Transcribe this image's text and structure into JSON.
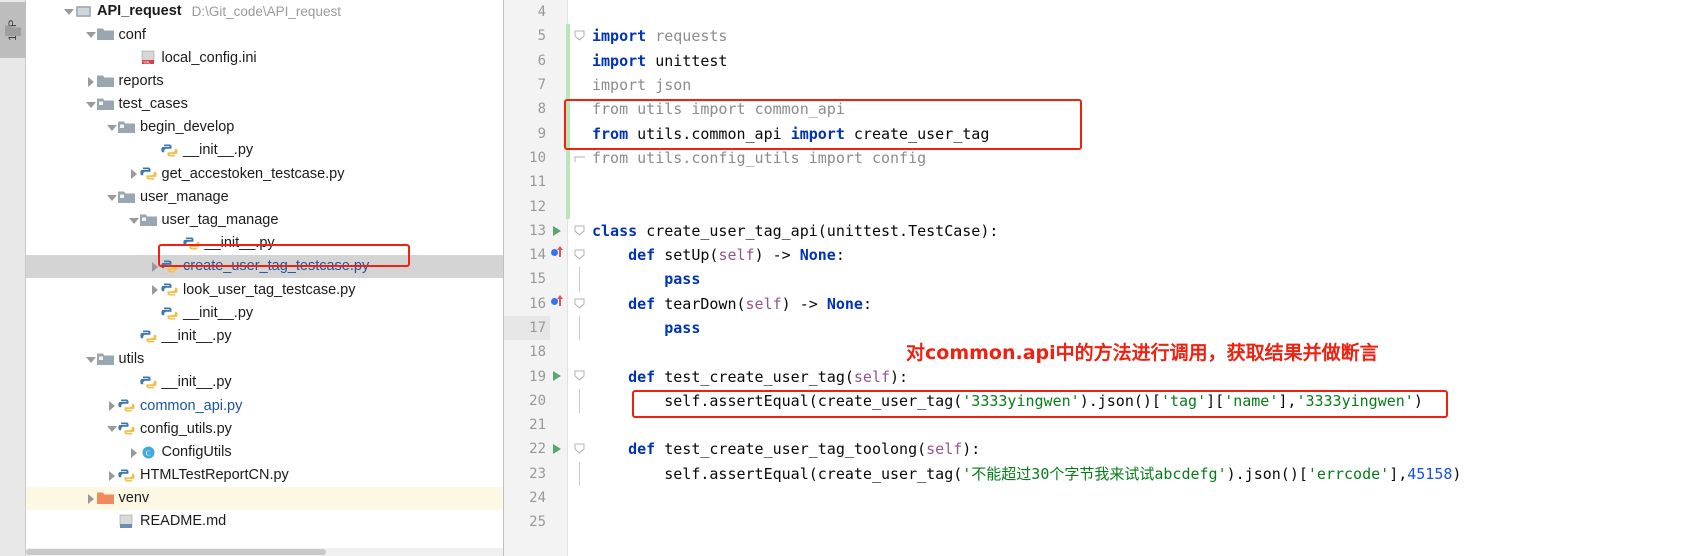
{
  "toolwindow": {
    "tab_label": "1: P",
    "folder_icon": "folder-icon"
  },
  "project_tree": {
    "title": "Project",
    "items": [
      {
        "indent": 0,
        "arrow": "down",
        "icon": "module-icon",
        "label": "API_request",
        "path": "D:\\Git_code\\API_request",
        "style": "bold",
        "state": "expanded"
      },
      {
        "indent": 1,
        "arrow": "down",
        "icon": "folder-icon",
        "label": "conf",
        "style": "normal",
        "state": "expanded"
      },
      {
        "indent": 3,
        "arrow": "none",
        "icon": "ini-file-icon",
        "label": "local_config.ini",
        "style": "normal",
        "state": "leaf"
      },
      {
        "indent": 1,
        "arrow": "right",
        "icon": "folder-icon",
        "label": "reports",
        "style": "normal",
        "state": "collapsed"
      },
      {
        "indent": 1,
        "arrow": "down",
        "icon": "source-folder-icon",
        "label": "test_cases",
        "style": "normal",
        "state": "expanded"
      },
      {
        "indent": 2,
        "arrow": "down",
        "icon": "source-folder-icon",
        "label": "begin_develop",
        "style": "normal",
        "state": "expanded"
      },
      {
        "indent": 4,
        "arrow": "none",
        "icon": "python-file-icon",
        "label": "__init__.py",
        "style": "normal",
        "state": "leaf"
      },
      {
        "indent": 3,
        "arrow": "right",
        "icon": "python-file-icon",
        "label": "get_accestoken_testcase.py",
        "style": "normal",
        "state": "collapsed"
      },
      {
        "indent": 2,
        "arrow": "down",
        "icon": "source-folder-icon",
        "label": "user_manage",
        "style": "normal",
        "state": "expanded"
      },
      {
        "indent": 3,
        "arrow": "down",
        "icon": "source-folder-icon",
        "label": "user_tag_manage",
        "style": "normal",
        "state": "expanded"
      },
      {
        "indent": 5,
        "arrow": "none",
        "icon": "python-file-icon",
        "label": "__init__.py",
        "style": "normal",
        "state": "leaf"
      },
      {
        "indent": 4,
        "arrow": "right",
        "icon": "python-file-icon",
        "label": "create_user_tag_testcase.py",
        "style": "blue",
        "state": "collapsed",
        "selected": true,
        "annotated": true
      },
      {
        "indent": 4,
        "arrow": "right",
        "icon": "python-file-icon",
        "label": "look_user_tag_testcase.py",
        "style": "normal",
        "state": "collapsed"
      },
      {
        "indent": 4,
        "arrow": "none",
        "icon": "python-file-icon",
        "label": "__init__.py",
        "style": "normal",
        "state": "leaf"
      },
      {
        "indent": 3,
        "arrow": "none",
        "icon": "python-file-icon",
        "label": "__init__.py",
        "style": "normal",
        "state": "leaf"
      },
      {
        "indent": 1,
        "arrow": "down",
        "icon": "source-folder-icon",
        "label": "utils",
        "style": "normal",
        "state": "expanded"
      },
      {
        "indent": 3,
        "arrow": "none",
        "icon": "python-file-icon",
        "label": "__init__.py",
        "style": "normal",
        "state": "leaf"
      },
      {
        "indent": 2,
        "arrow": "right",
        "icon": "python-file-icon",
        "label": "common_api.py",
        "style": "blue",
        "state": "collapsed"
      },
      {
        "indent": 2,
        "arrow": "down",
        "icon": "python-file-icon",
        "label": "config_utils.py",
        "style": "normal",
        "state": "expanded"
      },
      {
        "indent": 3,
        "arrow": "right",
        "icon": "class-icon",
        "label": "ConfigUtils",
        "style": "normal",
        "state": "collapsed"
      },
      {
        "indent": 2,
        "arrow": "right",
        "icon": "python-file-icon",
        "label": "HTMLTestReportCN.py",
        "style": "normal",
        "state": "collapsed"
      },
      {
        "indent": 1,
        "arrow": "right",
        "icon": "venv-folder-icon",
        "label": "venv",
        "style": "normal",
        "state": "collapsed",
        "highlight": "yellow"
      },
      {
        "indent": 2,
        "arrow": "none",
        "icon": "markdown-file-icon",
        "label": "README.md",
        "style": "normal",
        "state": "leaf"
      }
    ]
  },
  "editor": {
    "lines": [
      {
        "num": "4",
        "tokens": [],
        "gutter": "",
        "fold": ""
      },
      {
        "num": "5",
        "gutter": "",
        "fold": "fold-start",
        "tokens": [
          {
            "t": "import ",
            "c": "kw"
          },
          {
            "t": "requests",
            "c": "dim"
          }
        ]
      },
      {
        "num": "6",
        "gutter": "",
        "fold": "",
        "tokens": [
          {
            "t": "import ",
            "c": "kw"
          },
          {
            "t": "unittest",
            "c": "plain"
          }
        ]
      },
      {
        "num": "7",
        "gutter": "",
        "fold": "",
        "tokens": [
          {
            "t": "import ",
            "c": "dim"
          },
          {
            "t": "json",
            "c": "dim"
          }
        ]
      },
      {
        "num": "8",
        "gutter": "",
        "fold": "",
        "tokens": [
          {
            "t": "from ",
            "c": "dim"
          },
          {
            "t": "utils ",
            "c": "dim"
          },
          {
            "t": "import ",
            "c": "dim"
          },
          {
            "t": "common_api",
            "c": "dim"
          }
        ]
      },
      {
        "num": "9",
        "gutter": "",
        "fold": "",
        "tokens": [
          {
            "t": "from ",
            "c": "kw"
          },
          {
            "t": "utils.common_api ",
            "c": "plain"
          },
          {
            "t": "import ",
            "c": "kw"
          },
          {
            "t": "create_user_tag",
            "c": "plain"
          }
        ]
      },
      {
        "num": "10",
        "gutter": "",
        "fold": "fold-end",
        "tokens": [
          {
            "t": "from ",
            "c": "dim"
          },
          {
            "t": "utils.config_utils ",
            "c": "dim"
          },
          {
            "t": "import ",
            "c": "dim"
          },
          {
            "t": "config",
            "c": "dim"
          }
        ]
      },
      {
        "num": "11",
        "tokens": [],
        "gutter": "",
        "fold": ""
      },
      {
        "num": "12",
        "tokens": [],
        "gutter": "",
        "fold": ""
      },
      {
        "num": "13",
        "gutter": "run",
        "fold": "fold-start",
        "tokens": [
          {
            "t": "class ",
            "c": "kw"
          },
          {
            "t": "create_user_tag_api",
            "c": "plain"
          },
          {
            "t": "(unittest.TestCase):",
            "c": "plain"
          }
        ]
      },
      {
        "num": "14",
        "gutter": "override",
        "fold": "fold-start",
        "indent": 1,
        "tokens": [
          {
            "t": "    def ",
            "c": "kw"
          },
          {
            "t": "setUp",
            "c": "plain"
          },
          {
            "t": "(",
            "c": "plain"
          },
          {
            "t": "self",
            "c": "self"
          },
          {
            "t": ") -> ",
            "c": "plain"
          },
          {
            "t": "None",
            "c": "kw"
          },
          {
            "t": ":",
            "c": "plain"
          }
        ]
      },
      {
        "num": "15",
        "gutter": "",
        "fold": "fold-mid",
        "indent": 2,
        "tokens": [
          {
            "t": "        pass",
            "c": "kw"
          }
        ]
      },
      {
        "num": "16",
        "gutter": "override",
        "fold": "fold-start",
        "indent": 1,
        "tokens": [
          {
            "t": "    def ",
            "c": "kw"
          },
          {
            "t": "tearDown",
            "c": "plain"
          },
          {
            "t": "(",
            "c": "plain"
          },
          {
            "t": "self",
            "c": "self"
          },
          {
            "t": ") -> ",
            "c": "plain"
          },
          {
            "t": "None",
            "c": "kw"
          },
          {
            "t": ":",
            "c": "plain"
          }
        ]
      },
      {
        "num": "17",
        "gutter": "",
        "fold": "fold-mid",
        "indent": 2,
        "tokens": [
          {
            "t": "        pass",
            "c": "kw"
          }
        ]
      },
      {
        "num": "18",
        "tokens": [],
        "gutter": "",
        "fold": "",
        "indent": 1
      },
      {
        "num": "19",
        "gutter": "run",
        "fold": "fold-start",
        "indent": 1,
        "tokens": [
          {
            "t": "    def ",
            "c": "kw"
          },
          {
            "t": "test_create_user_tag",
            "c": "plain"
          },
          {
            "t": "(",
            "c": "plain"
          },
          {
            "t": "self",
            "c": "self"
          },
          {
            "t": "):",
            "c": "plain"
          }
        ]
      },
      {
        "num": "20",
        "gutter": "",
        "fold": "fold-mid",
        "indent": 2,
        "tokens": [
          {
            "t": "        self",
            "c": "plain"
          },
          {
            "t": ".assertEqual(create_user_tag(",
            "c": "plain"
          },
          {
            "t": "'3333yingwen'",
            "c": "str"
          },
          {
            "t": ").json()[",
            "c": "plain"
          },
          {
            "t": "'tag'",
            "c": "str"
          },
          {
            "t": "][",
            "c": "plain"
          },
          {
            "t": "'name'",
            "c": "str"
          },
          {
            "t": "],",
            "c": "plain"
          },
          {
            "t": "'3333yingwen'",
            "c": "str"
          },
          {
            "t": ")",
            "c": "plain"
          }
        ]
      },
      {
        "num": "21",
        "tokens": [],
        "gutter": "",
        "fold": "",
        "indent": 1
      },
      {
        "num": "22",
        "gutter": "run",
        "fold": "fold-start",
        "indent": 1,
        "tokens": [
          {
            "t": "    def ",
            "c": "kw"
          },
          {
            "t": "test_create_user_tag_toolong",
            "c": "plain"
          },
          {
            "t": "(",
            "c": "plain"
          },
          {
            "t": "self",
            "c": "self"
          },
          {
            "t": "):",
            "c": "plain"
          }
        ]
      },
      {
        "num": "23",
        "gutter": "",
        "fold": "fold-mid",
        "indent": 2,
        "tokens": [
          {
            "t": "        self",
            "c": "plain"
          },
          {
            "t": ".assertEqual(create_user_tag(",
            "c": "plain"
          },
          {
            "t": "'不能超过30个字节我来试试abcdefg'",
            "c": "str"
          },
          {
            "t": ").json()[",
            "c": "plain"
          },
          {
            "t": "'errcode'",
            "c": "str"
          },
          {
            "t": "],",
            "c": "plain"
          },
          {
            "t": "45158",
            "c": "num"
          },
          {
            "t": ")",
            "c": "plain"
          }
        ]
      },
      {
        "num": "24",
        "tokens": [],
        "gutter": "",
        "fold": "",
        "indent": 1
      },
      {
        "num": "25",
        "tokens": [],
        "gutter": "",
        "fold": ""
      }
    ],
    "annotation_note": "对common.api中的方法进行调用，获取结果并做断言",
    "annotation_color": "#ef2211"
  },
  "colors": {
    "annotation_red": "#ef2211",
    "keyword_blue": "#0033b3",
    "string_green": "#067d17",
    "number_blue": "#1750eb",
    "self_purple": "#94558d",
    "comment_gray": "#8c8c8c",
    "selection_gray": "#d4d4d4",
    "venv_highlight": "#fdf8e3",
    "link_blue": "#1a56a0"
  }
}
